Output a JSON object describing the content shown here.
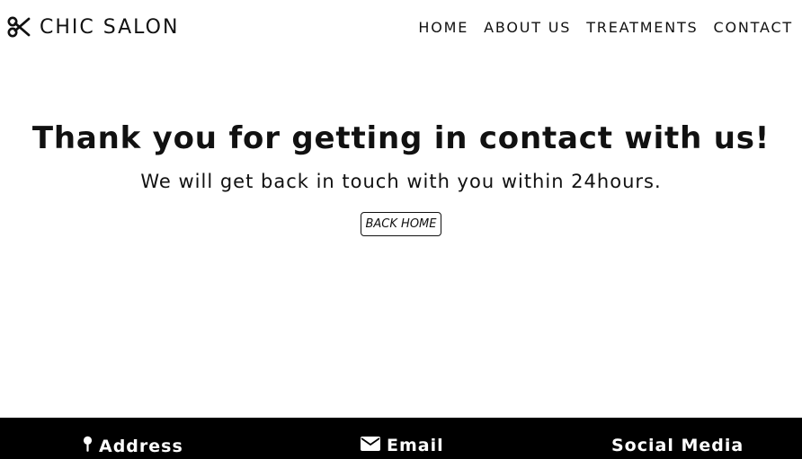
{
  "header": {
    "brand_name": "CHIC SALON",
    "brand_icon": "scissors-icon",
    "nav": [
      {
        "label": "HOME"
      },
      {
        "label": "ABOUT US"
      },
      {
        "label": "TREATMENTS"
      },
      {
        "label": "CONTACT"
      }
    ]
  },
  "main": {
    "title": "Thank you for getting in contact with us!",
    "subtitle": "We will get back in touch with you within 24hours.",
    "back_button": "BACK HOME"
  },
  "footer": {
    "background": "#000000",
    "address": {
      "label": "Address",
      "icon": "map-pin-icon"
    },
    "email": {
      "label": "Email",
      "icon": "envelope-icon"
    },
    "social": {
      "label": "Social Media"
    }
  }
}
